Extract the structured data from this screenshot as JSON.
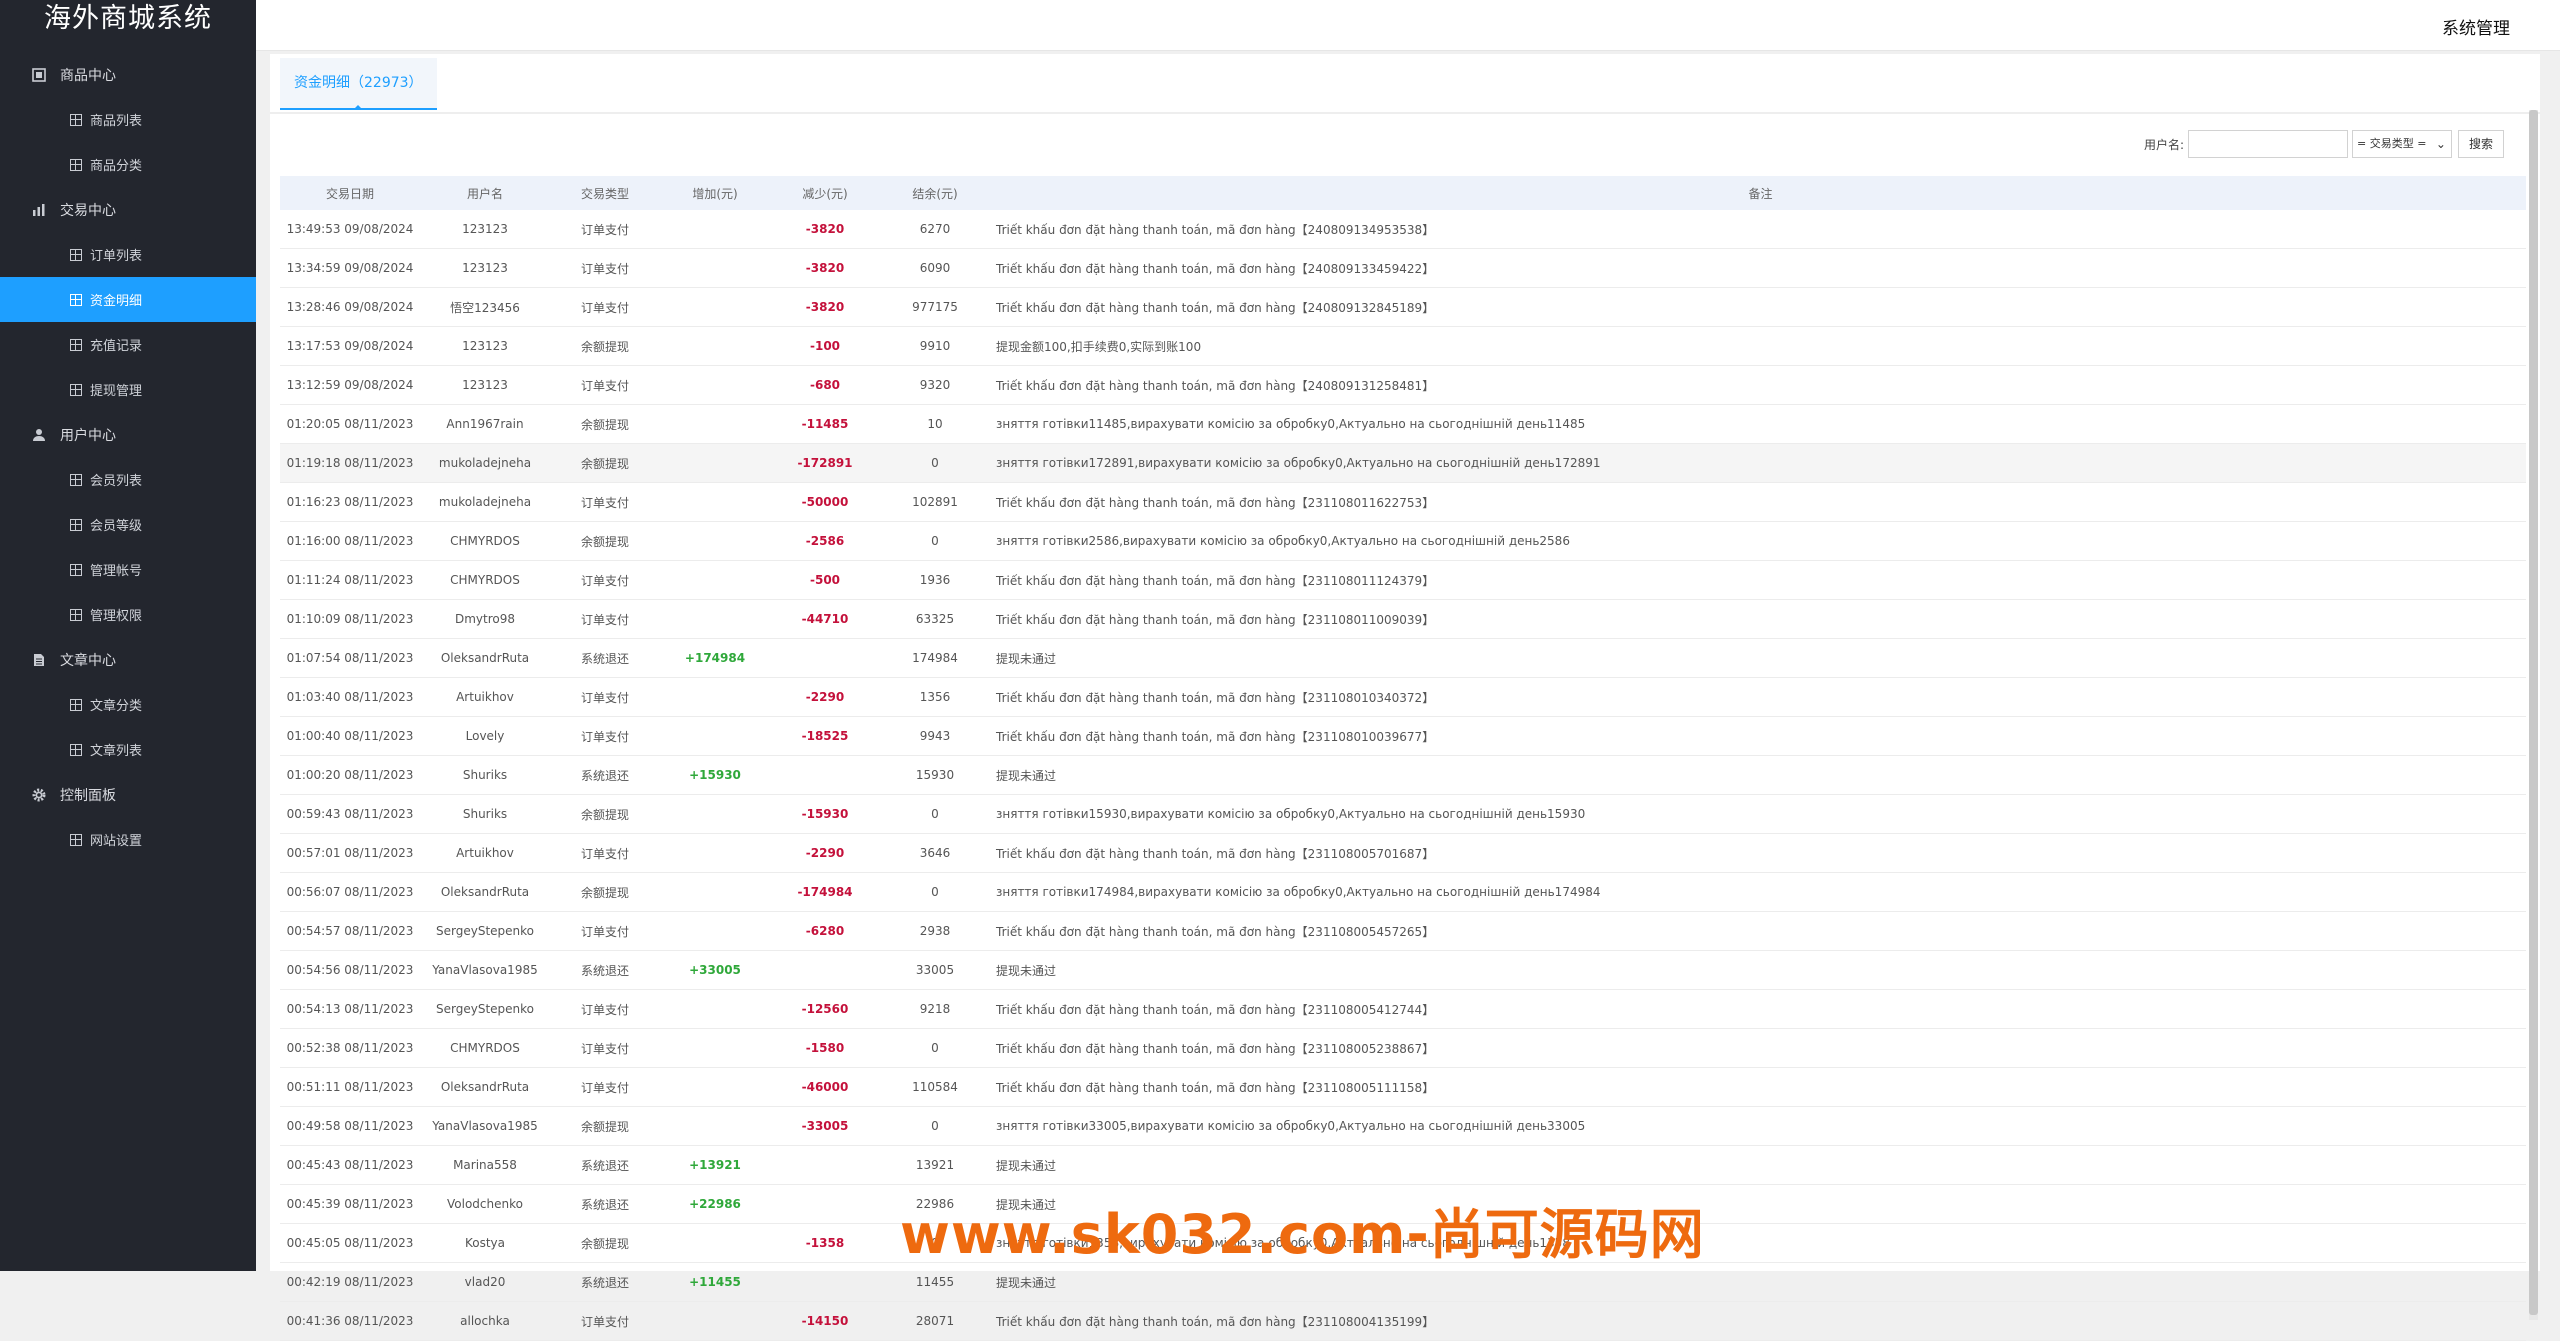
{
  "app": {
    "title": "海外商城系统",
    "header_right": "系统管理"
  },
  "sidebar": {
    "groups": [
      {
        "label": "商品中心",
        "icon": "product-icon",
        "items": [
          "商品列表",
          "商品分类"
        ]
      },
      {
        "label": "交易中心",
        "icon": "chart-icon",
        "items": [
          "订单列表",
          "资金明细",
          "充值记录",
          "提现管理"
        ]
      },
      {
        "label": "用户中心",
        "icon": "user-icon",
        "items": [
          "会员列表",
          "会员等级",
          "管理帐号",
          "管理权限"
        ]
      },
      {
        "label": "文章中心",
        "icon": "document-icon",
        "items": [
          "文章分类",
          "文章列表"
        ]
      },
      {
        "label": "控制面板",
        "icon": "gear-icon",
        "items": [
          "网站设置"
        ]
      }
    ],
    "active_item": "资金明细"
  },
  "tab": {
    "label": "资金明细（22973）"
  },
  "search": {
    "username_label": "用户名:",
    "username_value": "",
    "type_select": "= 交易类型 =",
    "button": "搜索"
  },
  "table": {
    "columns": [
      "交易日期",
      "用户名",
      "交易类型",
      "增加(元)",
      "减少(元)",
      "结余(元)",
      "备注"
    ],
    "rows": [
      [
        "13:49:53 09/08/2024",
        "123123",
        "订单支付",
        "",
        "-3820",
        "6270",
        "Triết khấu đơn đặt hàng thanh toán, mã đơn hàng【240809134953538】"
      ],
      [
        "13:34:59 09/08/2024",
        "123123",
        "订单支付",
        "",
        "-3820",
        "6090",
        "Triết khấu đơn đặt hàng thanh toán, mã đơn hàng【240809133459422】"
      ],
      [
        "13:28:46 09/08/2024",
        "悟空123456",
        "订单支付",
        "",
        "-3820",
        "977175",
        "Triết khấu đơn đặt hàng thanh toán, mã đơn hàng【240809132845189】"
      ],
      [
        "13:17:53 09/08/2024",
        "123123",
        "余额提现",
        "",
        "-100",
        "9910",
        "提现金额100,扣手续费0,实际到账100"
      ],
      [
        "13:12:59 09/08/2024",
        "123123",
        "订单支付",
        "",
        "-680",
        "9320",
        "Triết khấu đơn đặt hàng thanh toán, mã đơn hàng【240809131258481】"
      ],
      [
        "01:20:05 08/11/2023",
        "Ann1967rain",
        "余额提现",
        "",
        "-11485",
        "10",
        "зняття готівки11485,вирахувати комісію за обробку0,Актуально на сьогоднішній день11485"
      ],
      [
        "01:19:18 08/11/2023",
        "mukoladejneha",
        "余额提现",
        "",
        "-172891",
        "0",
        "зняття готівки172891,вирахувати комісію за обробку0,Актуально на сьогоднішній день172891"
      ],
      [
        "01:16:23 08/11/2023",
        "mukoladejneha",
        "订单支付",
        "",
        "-50000",
        "102891",
        "Triết khấu đơn đặt hàng thanh toán, mã đơn hàng【231108011622753】"
      ],
      [
        "01:16:00 08/11/2023",
        "CHMYRDOS",
        "余额提现",
        "",
        "-2586",
        "0",
        "зняття готівки2586,вирахувати комісію за обробку0,Актуально на сьогоднішній день2586"
      ],
      [
        "01:11:24 08/11/2023",
        "CHMYRDOS",
        "订单支付",
        "",
        "-500",
        "1936",
        "Triết khấu đơn đặt hàng thanh toán, mã đơn hàng【231108011124379】"
      ],
      [
        "01:10:09 08/11/2023",
        "Dmytro98",
        "订单支付",
        "",
        "-44710",
        "63325",
        "Triết khấu đơn đặt hàng thanh toán, mã đơn hàng【231108011009039】"
      ],
      [
        "01:07:54 08/11/2023",
        "OleksandrRuta",
        "系统退还",
        "+174984",
        "",
        "174984",
        "提现未通过"
      ],
      [
        "01:03:40 08/11/2023",
        "Artuikhov",
        "订单支付",
        "",
        "-2290",
        "1356",
        "Triết khấu đơn đặt hàng thanh toán, mã đơn hàng【231108010340372】"
      ],
      [
        "01:00:40 08/11/2023",
        "Lovely",
        "订单支付",
        "",
        "-18525",
        "9943",
        "Triết khấu đơn đặt hàng thanh toán, mã đơn hàng【231108010039677】"
      ],
      [
        "01:00:20 08/11/2023",
        "Shuriks",
        "系统退还",
        "+15930",
        "",
        "15930",
        "提现未通过"
      ],
      [
        "00:59:43 08/11/2023",
        "Shuriks",
        "余额提现",
        "",
        "-15930",
        "0",
        "зняття готівки15930,вирахувати комісію за обробку0,Актуально на сьогоднішній день15930"
      ],
      [
        "00:57:01 08/11/2023",
        "Artuikhov",
        "订单支付",
        "",
        "-2290",
        "3646",
        "Triết khấu đơn đặt hàng thanh toán, mã đơn hàng【231108005701687】"
      ],
      [
        "00:56:07 08/11/2023",
        "OleksandrRuta",
        "余额提现",
        "",
        "-174984",
        "0",
        "зняття готівки174984,вирахувати комісію за обробку0,Актуально на сьогоднішній день174984"
      ],
      [
        "00:54:57 08/11/2023",
        "SergeyStepenko",
        "订单支付",
        "",
        "-6280",
        "2938",
        "Triết khấu đơn đặt hàng thanh toán, mã đơn hàng【231108005457265】"
      ],
      [
        "00:54:56 08/11/2023",
        "YanaVlasova1985",
        "系统退还",
        "+33005",
        "",
        "33005",
        "提现未通过"
      ],
      [
        "00:54:13 08/11/2023",
        "SergeyStepenko",
        "订单支付",
        "",
        "-12560",
        "9218",
        "Triết khấu đơn đặt hàng thanh toán, mã đơn hàng【231108005412744】"
      ],
      [
        "00:52:38 08/11/2023",
        "CHMYRDOS",
        "订单支付",
        "",
        "-1580",
        "0",
        "Triết khấu đơn đặt hàng thanh toán, mã đơn hàng【231108005238867】"
      ],
      [
        "00:51:11 08/11/2023",
        "OleksandrRuta",
        "订单支付",
        "",
        "-46000",
        "110584",
        "Triết khấu đơn đặt hàng thanh toán, mã đơn hàng【231108005111158】"
      ],
      [
        "00:49:58 08/11/2023",
        "YanaVlasova1985",
        "余额提现",
        "",
        "-33005",
        "0",
        "зняття готівки33005,вирахувати комісію за обробку0,Актуально на сьогоднішній день33005"
      ],
      [
        "00:45:43 08/11/2023",
        "Marina558",
        "系统退还",
        "+13921",
        "",
        "13921",
        "提现未通过"
      ],
      [
        "00:45:39 08/11/2023",
        "Volodchenko",
        "系统退还",
        "+22986",
        "",
        "22986",
        "提现未通过"
      ],
      [
        "00:45:05 08/11/2023",
        "Kostya",
        "余额提现",
        "",
        "-1358",
        "0",
        "зняття готівки1358,вирахувати комісію за обробку0,Актуально на сьогоднішній день1358"
      ],
      [
        "00:42:19 08/11/2023",
        "vlad20",
        "系统退还",
        "+11455",
        "",
        "11455",
        "提现未通过"
      ],
      [
        "00:41:36 08/11/2023",
        "allochka",
        "订单支付",
        "",
        "-14150",
        "28071",
        "Triết khấu đơn đặt hàng thanh toán, mã đơn hàng【231108004135199】"
      ]
    ],
    "highlight_row": 6
  },
  "watermark": "www.sk032.com-尚可源码网",
  "colors": {
    "sidebar_bg": "#23262e",
    "accent": "#1e9fff",
    "increase": "#2fa83a",
    "decrease": "#c4113b"
  }
}
